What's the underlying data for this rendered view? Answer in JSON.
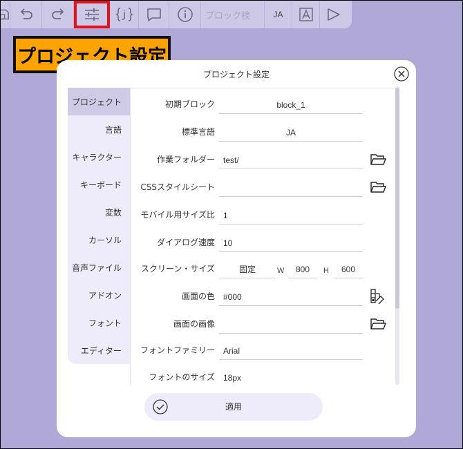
{
  "toolbar": {
    "search_placeholder": "ブロック検",
    "lang": "JA",
    "buttons": [
      "save-icon",
      "undo-icon",
      "redo-icon",
      "settings-sliders-icon",
      "variables-icon",
      "comment-icon",
      "info-icon",
      "translate-icon",
      "play-icon"
    ]
  },
  "callout": {
    "text": "プロジェクト設定"
  },
  "dialog": {
    "title": "プロジェクト設定",
    "apply_label": "適用",
    "nav": [
      {
        "label": "プロジェクト",
        "active": true
      },
      {
        "label": "言語"
      },
      {
        "label": "キャラクター"
      },
      {
        "label": "キーボード"
      },
      {
        "label": "変数"
      },
      {
        "label": "カーソル"
      },
      {
        "label": "音声ファイル"
      },
      {
        "label": "アドオン"
      },
      {
        "label": "フォント"
      },
      {
        "label": "エディター"
      }
    ],
    "fields": {
      "initial_block": {
        "label": "初期ブロック",
        "value": "block_1"
      },
      "default_lang": {
        "label": "標準言語",
        "value": "JA"
      },
      "work_folder": {
        "label": "作業フォルダー",
        "value": "test/"
      },
      "css": {
        "label": "CSSスタイルシート",
        "value": ""
      },
      "mobile_ratio": {
        "label": "モバイル用サイズ比",
        "value": "1"
      },
      "dialog_speed": {
        "label": "ダイアログ速度",
        "value": "10"
      },
      "screen_size": {
        "label": "スクリーン・サイズ",
        "mode": "固定",
        "w_label": "W",
        "w": "800",
        "h_label": "H",
        "h": "600"
      },
      "screen_color": {
        "label": "画面の色",
        "value": "#000"
      },
      "screen_image": {
        "label": "画面の画像",
        "value": ""
      },
      "font_family": {
        "label": "フォントファミリー",
        "value": "Arial"
      },
      "font_size": {
        "label": "フォントのサイズ",
        "value": "18px"
      }
    }
  },
  "colors": {
    "background": "#b0a8d6",
    "toolbar": "#cdc8e6",
    "callout": "#ffa300",
    "highlight": "#e5121d",
    "nav_bg": "#eeecfb",
    "nav_active": "#cfcbe6"
  }
}
